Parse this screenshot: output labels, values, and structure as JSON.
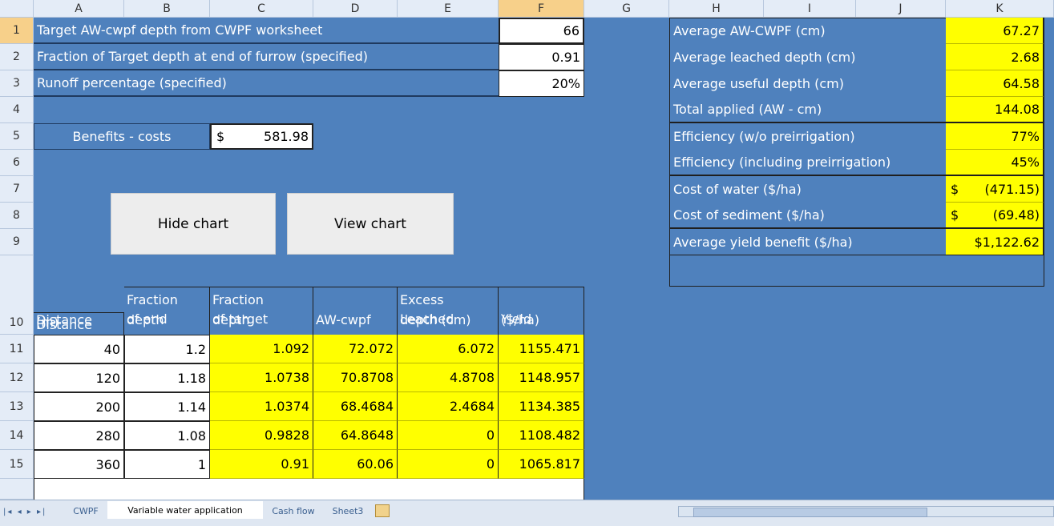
{
  "columns": [
    "A",
    "B",
    "C",
    "D",
    "E",
    "F",
    "G",
    "H",
    "I",
    "J",
    "K"
  ],
  "rows": [
    "1",
    "2",
    "3",
    "4",
    "5",
    "6",
    "7",
    "8",
    "9",
    "10",
    "11",
    "12",
    "13",
    "14",
    "15"
  ],
  "params": [
    {
      "label": "Target AW-cwpf depth from CWPF worksheet",
      "value": "66"
    },
    {
      "label": "Fraction of Target depth at end of furrow (specified)",
      "value": "0.91"
    },
    {
      "label": "Runoff percentage (specified)",
      "value": "20%"
    }
  ],
  "benefits": {
    "label": "Benefits - costs",
    "currency": "$",
    "value": "581.98"
  },
  "buttons": {
    "hide": "Hide chart",
    "view": "View chart"
  },
  "summary": [
    {
      "label": "Average AW-CWPF (cm)",
      "value": "67.27"
    },
    {
      "label": "Average leached depth (cm)",
      "value": "2.68"
    },
    {
      "label": "Average useful depth (cm)",
      "value": "64.58"
    },
    {
      "label": "Total applied (AW - cm)",
      "value": "144.08"
    },
    {
      "label": "Efficiency (w/o preirrigation)",
      "value": "77%"
    },
    {
      "label": "Efficiency (including preirrigation)",
      "value": "45%"
    },
    {
      "label": "Cost of water ($/ha)",
      "currency": "$",
      "value": "(471.15)"
    },
    {
      "label": "Cost of sediment ($/ha)",
      "currency": "$",
      "value": "(69.48)"
    },
    {
      "label": "Average yield benefit ($/ha)",
      "value": "$1,122.62"
    }
  ],
  "table": {
    "headers": [
      [
        "Distance",
        "(m)"
      ],
      [
        "Fraction",
        "of end",
        "depth"
      ],
      [
        "Fraction",
        "of target",
        "depth"
      ],
      [
        "AW-cwpf"
      ],
      [
        "Excess",
        "Leached",
        "depth (cm)"
      ],
      [
        "Yield",
        "($/ha)"
      ]
    ],
    "rows": [
      [
        "40",
        "1.2",
        "1.092",
        "72.072",
        "6.072",
        "1155.471"
      ],
      [
        "120",
        "1.18",
        "1.0738",
        "70.8708",
        "4.8708",
        "1148.957"
      ],
      [
        "200",
        "1.14",
        "1.0374",
        "68.4684",
        "2.4684",
        "1134.385"
      ],
      [
        "280",
        "1.08",
        "0.9828",
        "64.8648",
        "0",
        "1108.482"
      ],
      [
        "360",
        "1",
        "0.91",
        "60.06",
        "0",
        "1065.817"
      ]
    ]
  },
  "sheet_tabs": [
    "CWPF",
    "Variable water application",
    "Cash flow",
    "Sheet3"
  ],
  "colors": {
    "blue": "#4f81bd",
    "yellow": "#ffff00",
    "header": "#e4ecf7",
    "selected_header": "#f7d08a"
  }
}
